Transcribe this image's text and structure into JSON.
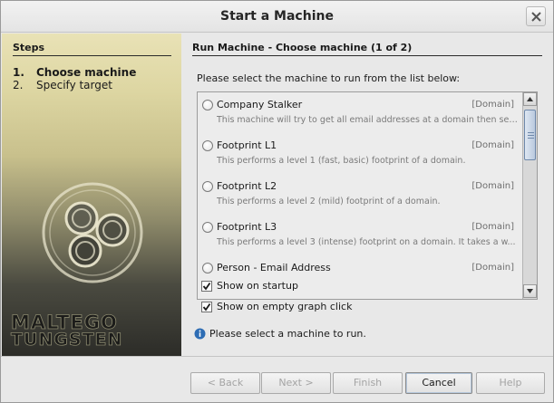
{
  "window": {
    "title": "Start a Machine"
  },
  "steps": {
    "heading": "Steps",
    "items": [
      {
        "num": "1.",
        "label": "Choose machine",
        "active": true
      },
      {
        "num": "2.",
        "label": "Specify target",
        "active": false
      }
    ],
    "brand": {
      "line1": "MALTEGO",
      "line2": "TUNGSTEN"
    }
  },
  "main": {
    "heading": "Run Machine - Choose machine (1 of 2)",
    "instruction": "Please select the machine to run from the list below:",
    "machines": [
      {
        "name": "Company Stalker",
        "tag": "[Domain]",
        "desc": "This machine will try to get all email addresses at a domain then see..."
      },
      {
        "name": "Footprint L1",
        "tag": "[Domain]",
        "desc": "This performs a level 1 (fast, basic) footprint of a domain."
      },
      {
        "name": "Footprint L2",
        "tag": "[Domain]",
        "desc": "This performs a level 2 (mild) footprint of a domain."
      },
      {
        "name": "Footprint L3",
        "tag": "[Domain]",
        "desc": "This performs a level 3 (intense) footprint on a domain. It takes a w..."
      },
      {
        "name": "Person - Email Address",
        "tag": "[Domain]",
        "desc": ""
      }
    ],
    "show_on_startup": {
      "label": "Show on startup",
      "checked": true
    },
    "show_on_empty": {
      "label": "Show on empty graph click",
      "checked": true
    },
    "status": "Please select a machine to run.",
    "status_icon": "info-icon"
  },
  "buttons": {
    "back": "< Back",
    "next": "Next >",
    "finish": "Finish",
    "cancel": "Cancel",
    "help": "Help"
  },
  "colors": {
    "accent": "#2e6db4",
    "scroll_thumb": "#b9c9de"
  }
}
